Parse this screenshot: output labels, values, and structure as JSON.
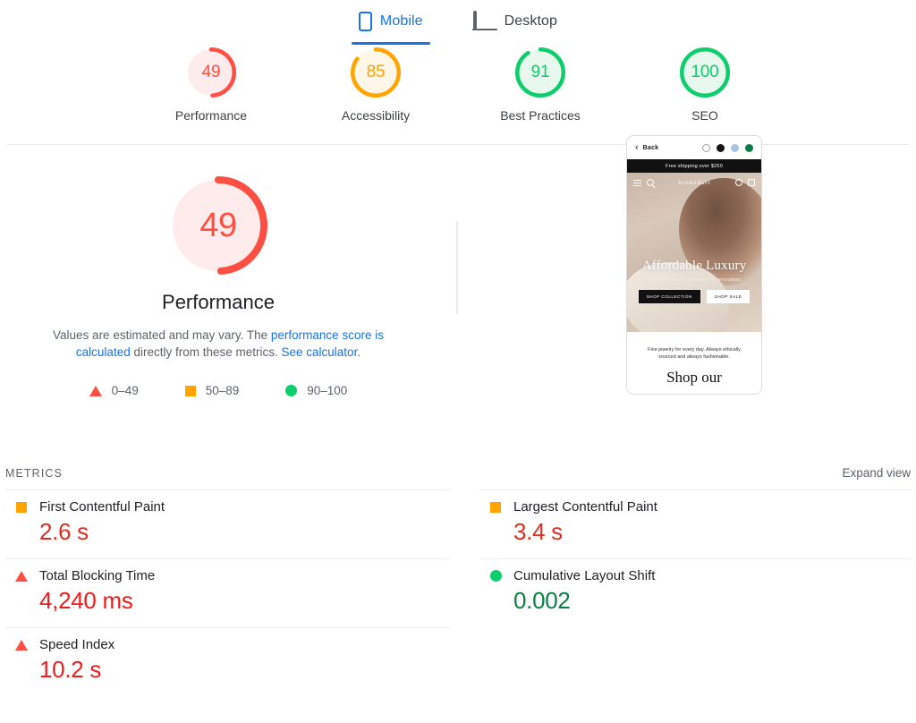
{
  "tabs": [
    {
      "label": "Mobile",
      "icon": "mobile-icon",
      "active": true
    },
    {
      "label": "Desktop",
      "icon": "desktop-icon",
      "active": false
    }
  ],
  "category_scores": [
    {
      "label": "Performance",
      "score": "49",
      "value": 49,
      "color": "#ff4e42",
      "bg": "#fdeceb"
    },
    {
      "label": "Accessibility",
      "score": "85",
      "value": 85,
      "color": "#ffa400",
      "bg": "#fef6e7"
    },
    {
      "label": "Best Practices",
      "score": "91",
      "value": 91,
      "color": "#0cce6b",
      "bg": "#e9f8ef"
    },
    {
      "label": "SEO",
      "score": "100",
      "value": 100,
      "color": "#0cce6b",
      "bg": "#e9f8ef"
    }
  ],
  "hero": {
    "score": "49",
    "score_value": 49,
    "caption": "Performance",
    "color": "#ff4e42",
    "bg": "#fdeceb",
    "disclaimer_lead": "Values are estimated and may vary. The ",
    "disclaimer_link1": "performance score is calculated",
    "disclaimer_mid": " directly from these metrics. ",
    "disclaimer_link2": "See calculator."
  },
  "legend": [
    {
      "shape": "triangle",
      "label": "0–49",
      "color": "#ff4e42"
    },
    {
      "shape": "square",
      "label": "50–89",
      "color": "#ffa400"
    },
    {
      "shape": "circle",
      "label": "90–100",
      "color": "#0cce6b"
    }
  ],
  "screenshot": {
    "back_label": "Back",
    "banner": "Free shipping over $250",
    "brand": "brokedast",
    "hero_title": "Affordable Luxury",
    "hero_subtitle": "Beautiful pieces to pass down for generations.",
    "btn_primary": "SHOP COLLECTION",
    "btn_secondary": "SHOP SALE",
    "tagline": "Fine jewelry for every day. Always ethically sourced and always fashionable.",
    "shop_heading": "Shop our",
    "swatches": [
      "white",
      "black",
      "light-blue",
      "green"
    ]
  },
  "metrics": {
    "section_title": "METRICS",
    "expand_label": "Expand view",
    "left": [
      {
        "name": "First Contentful Paint",
        "value": "2.6 s",
        "status": "average",
        "shape": "square",
        "value_color": "#d93025"
      },
      {
        "name": "Total Blocking Time",
        "value": "4,240 ms",
        "status": "poor",
        "shape": "triangle",
        "value_color": "#f01c1c"
      },
      {
        "name": "Speed Index",
        "value": "10.2 s",
        "status": "poor",
        "shape": "triangle",
        "value_color": "#f01c1c"
      }
    ],
    "right": [
      {
        "name": "Largest Contentful Paint",
        "value": "3.4 s",
        "status": "average",
        "shape": "square",
        "value_color": "#d93025"
      },
      {
        "name": "Cumulative Layout Shift",
        "value": "0.002",
        "status": "good",
        "shape": "circle",
        "value_color": "#0b8043"
      }
    ]
  }
}
